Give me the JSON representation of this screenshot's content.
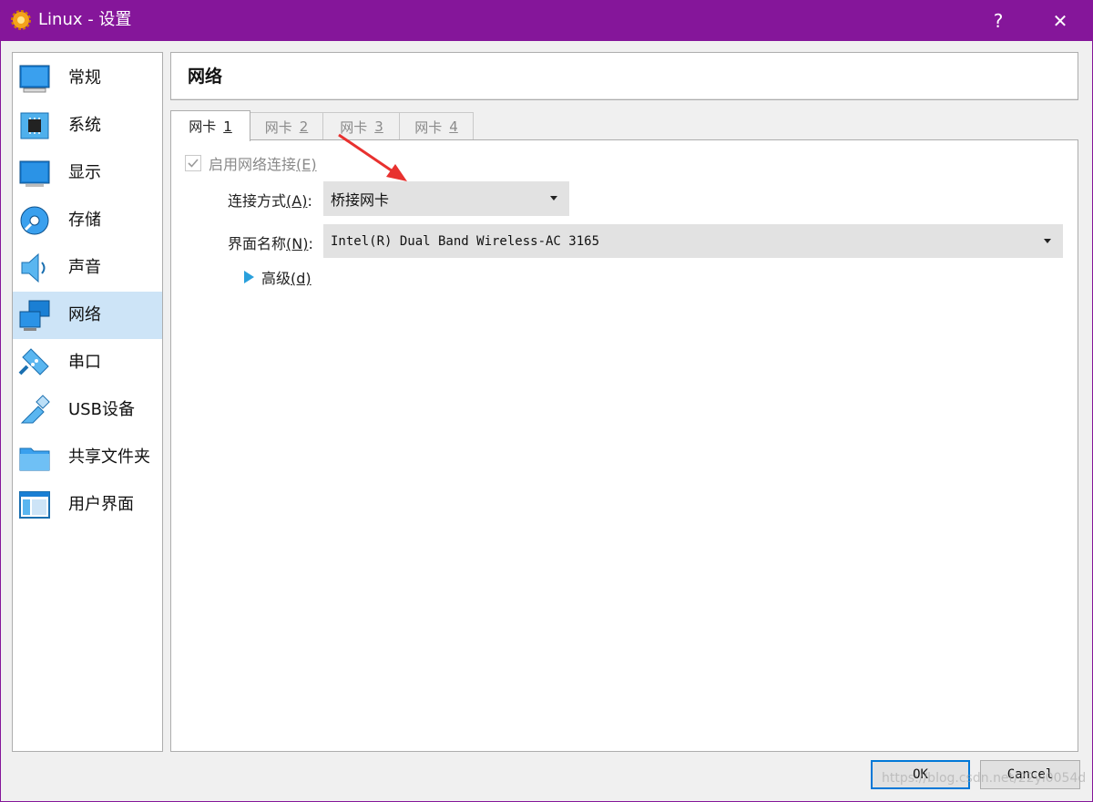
{
  "window": {
    "title": "Linux - 设置",
    "help_glyph": "?",
    "close_glyph": "✕",
    "title_bar_color": "#85169a"
  },
  "sidebar": {
    "items": [
      {
        "label": "常规",
        "icon": "monitor-icon"
      },
      {
        "label": "系统",
        "icon": "chip-icon"
      },
      {
        "label": "显示",
        "icon": "display-icon"
      },
      {
        "label": "存储",
        "icon": "disk-icon"
      },
      {
        "label": "声音",
        "icon": "speaker-icon"
      },
      {
        "label": "网络",
        "icon": "network-icon",
        "selected": true
      },
      {
        "label": "串口",
        "icon": "serial-port-icon"
      },
      {
        "label": "USB设备",
        "icon": "usb-icon"
      },
      {
        "label": "共享文件夹",
        "icon": "folder-icon"
      },
      {
        "label": "用户界面",
        "icon": "ui-window-icon"
      }
    ]
  },
  "main": {
    "header_title": "网络",
    "tabs": [
      {
        "label": "网卡",
        "number": "1",
        "active": true
      },
      {
        "label": "网卡",
        "number": "2"
      },
      {
        "label": "网卡",
        "number": "3"
      },
      {
        "label": "网卡",
        "number": "4"
      }
    ],
    "enable_network": {
      "label": "启用网络连接",
      "accel": "(E)",
      "checked": true
    },
    "attached_to": {
      "label": "连接方式",
      "accel": "(A)",
      "suffix": ":",
      "value": "桥接网卡"
    },
    "interface_name": {
      "label": "界面名称",
      "accel": "(N)",
      "suffix": ":",
      "value": "Intel(R) Dual Band Wireless-AC 3165"
    },
    "advanced": {
      "label": "高级",
      "accel": "(d)"
    }
  },
  "buttons": {
    "ok": "OK",
    "cancel": "Cancel"
  },
  "watermark": "https://blog.csdn.net/22yl0054d",
  "colors": {
    "accent": "#0078d7",
    "selection": "#cde4f7",
    "annotation_arrow": "#e8312f"
  }
}
